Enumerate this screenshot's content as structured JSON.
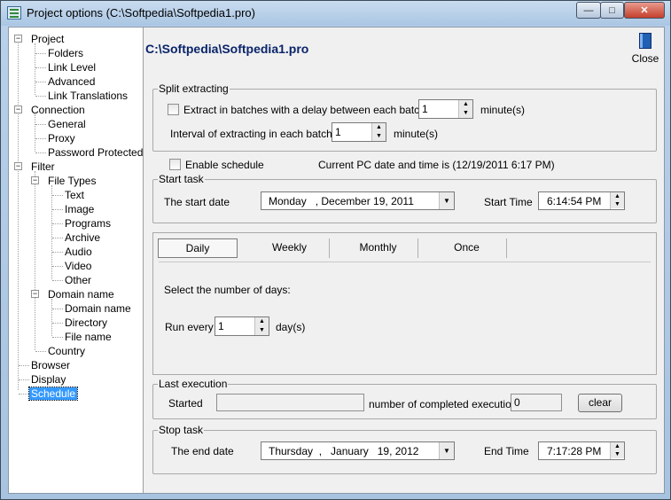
{
  "window": {
    "title": "Project options (C:\\Softpedia\\Softpedia1.pro)",
    "minimize": "0",
    "maximize": "1",
    "close": "r"
  },
  "tree": [
    {
      "label": "Project",
      "expanded": true
    },
    {
      "label": "Folders"
    },
    {
      "label": "Link Level"
    },
    {
      "label": "Advanced"
    },
    {
      "label": "Link Translations"
    },
    {
      "label": "Connection",
      "expanded": true
    },
    {
      "label": "General"
    },
    {
      "label": "Proxy"
    },
    {
      "label": "Password Protected"
    },
    {
      "label": "Filter",
      "expanded": true
    },
    {
      "label": "File Types",
      "expanded": true
    },
    {
      "label": "Text"
    },
    {
      "label": "Image"
    },
    {
      "label": "Programs"
    },
    {
      "label": "Archive"
    },
    {
      "label": "Audio"
    },
    {
      "label": "Video"
    },
    {
      "label": "Other"
    },
    {
      "label": "Domain name",
      "expanded": true
    },
    {
      "label": "Domain name"
    },
    {
      "label": "Directory"
    },
    {
      "label": "File name"
    },
    {
      "label": "Country"
    },
    {
      "label": "Browser"
    },
    {
      "label": "Display"
    },
    {
      "label": "Schedule",
      "selected": true
    }
  ],
  "main": {
    "project_path": "C:\\Softpedia\\Softpedia1.pro",
    "close_label": "Close",
    "split": {
      "legend": "Split extracting",
      "batches_label": "Extract in batches with a delay between each batch =",
      "batches_value": "1",
      "batches_unit": "minute(s)",
      "interval_label": "Interval of extracting in each batch",
      "interval_value": "1",
      "interval_unit": "minute(s)"
    },
    "enable_schedule_label": "Enable schedule",
    "current_time_text": "Current PC date and time is (12/19/2011 6:17 PM)",
    "start_task": {
      "legend": "Start task",
      "date_label": "The start date",
      "date_value": "Monday   , December 19, 2011",
      "time_label": "Start Time",
      "time_value": "6:14:54 PM"
    },
    "schedule_tabs": [
      "Daily",
      "Weekly",
      "Monthly",
      "Once"
    ],
    "active_tab": "Daily",
    "daily": {
      "prompt": "Select the number of days:",
      "run_every_label": "Run every",
      "run_every_value": "1",
      "run_every_unit": "day(s)"
    },
    "last_execution": {
      "legend": "Last execution",
      "started_label": "Started",
      "started_value": "",
      "completed_label": "number of completed executions",
      "completed_value": "0",
      "clear_label": "clear"
    },
    "stop_task": {
      "legend": "Stop task",
      "date_label": "The end date",
      "date_value": "Thursday  ,   January   19, 2012",
      "time_label": "End Time",
      "time_value": "7:17:28 PM"
    }
  }
}
